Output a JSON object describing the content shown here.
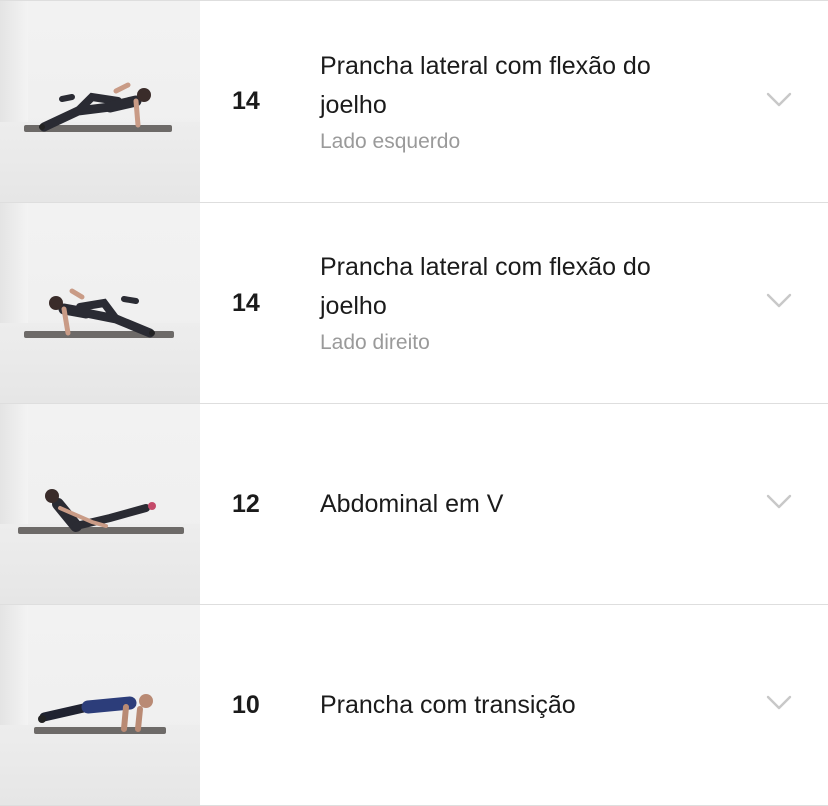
{
  "exercises": [
    {
      "reps": "14",
      "title": "Prancha lateral com flexão do joelho",
      "subtitle": "Lado esquerdo",
      "thumbnail": "woman-side-plank-knee-left-photo",
      "chevron": "chevron-down-icon"
    },
    {
      "reps": "14",
      "title": "Prancha lateral com flexão do joelho",
      "subtitle": "Lado direito",
      "thumbnail": "woman-side-plank-knee-right-photo",
      "chevron": "chevron-down-icon"
    },
    {
      "reps": "12",
      "title": "Abdominal em V",
      "subtitle": "",
      "thumbnail": "woman-v-sit-photo",
      "chevron": "chevron-down-icon"
    },
    {
      "reps": "10",
      "title": "Prancha com transição",
      "subtitle": "",
      "thumbnail": "man-plank-transition-photo",
      "chevron": "chevron-down-icon"
    }
  ],
  "colors": {
    "text": "#1b1b1b",
    "subtext": "#9a9a9a",
    "divider": "#dedede",
    "chevron": "#c8c8c8"
  }
}
